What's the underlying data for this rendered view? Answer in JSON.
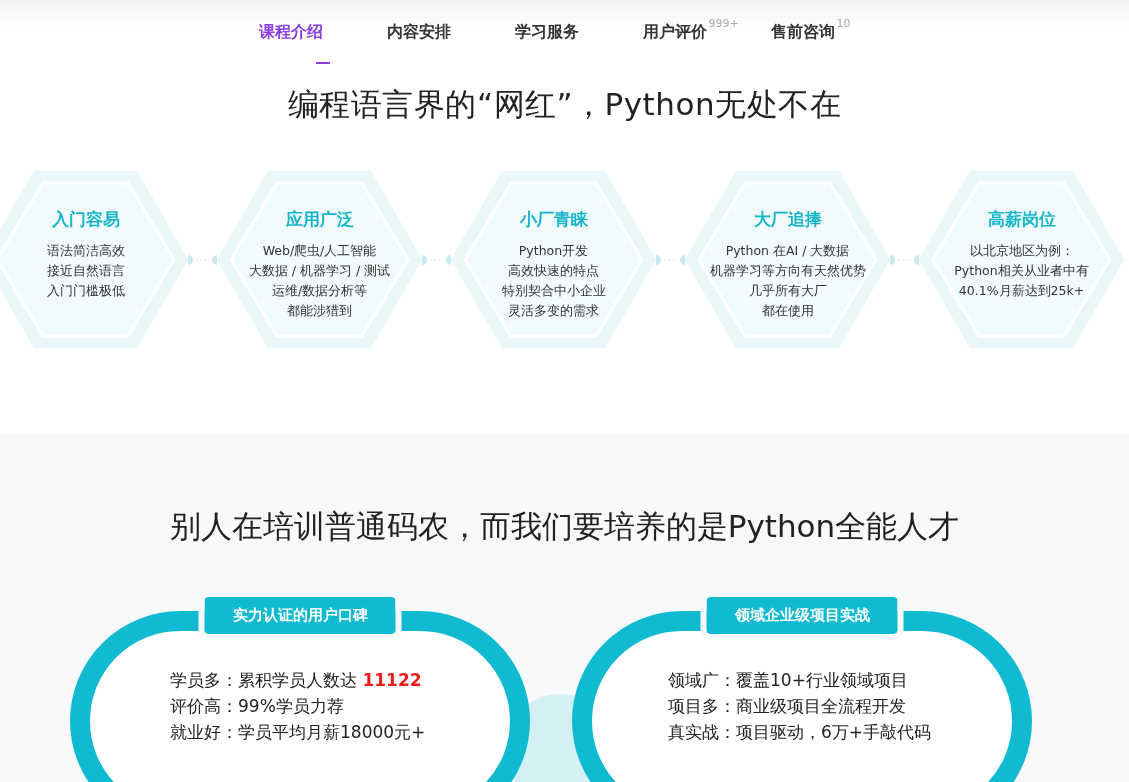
{
  "tabs": [
    {
      "label": "课程介绍",
      "selected": true
    },
    {
      "label": "内容安排",
      "selected": false
    },
    {
      "label": "学习服务",
      "selected": false
    },
    {
      "label": "用户评价",
      "selected": false,
      "count": "999+"
    },
    {
      "label": "售前咨询",
      "selected": false,
      "count": "10"
    }
  ],
  "intro": {
    "title": "编程语言界的“网红”，Python无处不在",
    "features": [
      {
        "title": "入门容易",
        "lines": [
          "语法简洁高效",
          "接近自然语言",
          "入门门槛极低"
        ]
      },
      {
        "title": "应用广泛",
        "lines": [
          "Web/爬虫/人工智能",
          "大数据 / 机器学习 / 测试",
          "运维/数据分析等",
          "都能涉猎到"
        ]
      },
      {
        "title": "小厂青睐",
        "lines": [
          "Python开发",
          "高效快速的特点",
          "特别契合中小企业",
          "灵活多变的需求"
        ]
      },
      {
        "title": "大厂追捧",
        "lines": [
          "Python 在AI / 大数据",
          "机器学习等方向有天然优势",
          "几乎所有大厂",
          "都在使用"
        ]
      },
      {
        "title": "高薪岗位",
        "lines": [
          "以北京地区为例：",
          "Python相关从业者中有",
          "40.1%月薪达到25k+"
        ]
      }
    ]
  },
  "talent": {
    "title": "别人在培训普通码农，而我们要培养的是Python全能人才",
    "cards": [
      {
        "heading": "实力认证的用户口碑",
        "lines": [
          {
            "label": "学员多：",
            "text": "累积学员人数达 ",
            "highlight": "11122"
          },
          {
            "label": "评价高：",
            "text": "99%学员力荐"
          },
          {
            "label": "就业好：",
            "text": "学员平均月薪18000元+"
          }
        ]
      },
      {
        "heading": "领域企业级项目实战",
        "lines": [
          {
            "label": "领域广：",
            "text": "覆盖10+行业领域项目"
          },
          {
            "label": "项目多：",
            "text": "商业级项目全流程开发"
          },
          {
            "label": "真实战：",
            "text": "项目驱动，6万+手敲代码"
          }
        ]
      }
    ]
  }
}
